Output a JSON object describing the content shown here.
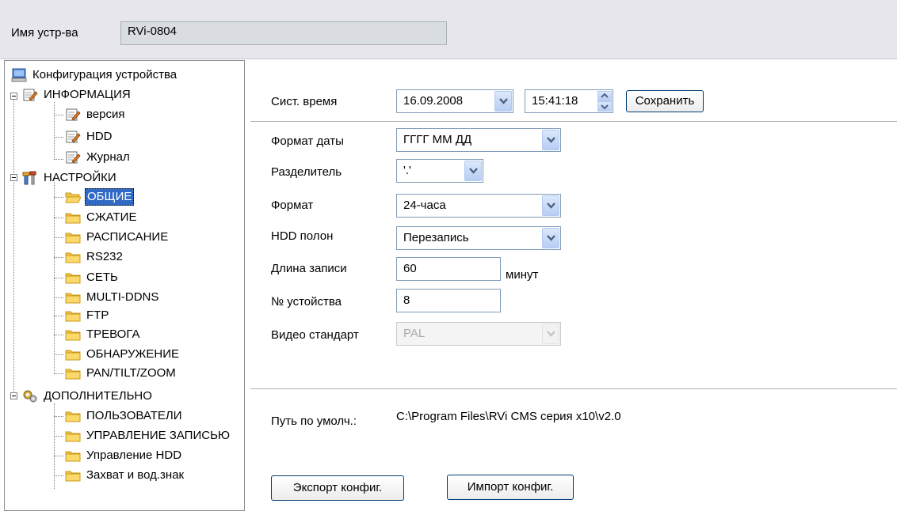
{
  "header": {
    "device_name_label": "Имя устр-ва",
    "device_name_value": "RVi-0804"
  },
  "tree": {
    "root": "Конфигурация устройства",
    "info_group": "ИНФОРМАЦИЯ",
    "info_items": [
      "версия",
      "HDD",
      "Журнал"
    ],
    "settings_group": "НАСТРОЙКИ",
    "settings_items": [
      "ОБЩИЕ",
      "СЖАТИЕ",
      "РАСПИСАНИЕ",
      "RS232",
      "СЕТЬ",
      "MULTI-DDNS",
      "FTP",
      "ТРЕВОГА",
      "ОБНАРУЖЕНИЕ",
      "PAN/TILT/ZOOM"
    ],
    "selected_item": "ОБЩИЕ",
    "extra_group": "ДОПОЛНИТЕЛЬНО",
    "extra_items": [
      "ПОЛЬЗОВАТЕЛИ",
      "УПРАВЛЕНИЕ ЗАПИСЬЮ",
      "Управление HDD",
      "Захват и вод.знак"
    ]
  },
  "system_time": {
    "label": "Сист. время",
    "date": "16.09.2008",
    "time": "15:41:18",
    "save_button": "Сохранить"
  },
  "settings": {
    "date_format": {
      "label": "Формат даты",
      "value": "ГГГГ ММ ДД"
    },
    "separator": {
      "label": "Разделитель",
      "value": "'.'"
    },
    "time_format": {
      "label": "Формат",
      "value": "24-часа"
    },
    "hdd_full": {
      "label": "HDD полон",
      "value": "Перезапись"
    },
    "record_length": {
      "label": "Длина записи",
      "value": "60",
      "unit": "минут"
    },
    "device_no": {
      "label": "№ устойства",
      "value": "8"
    },
    "video_standard": {
      "label": "Видео стандарт",
      "value": "PAL"
    }
  },
  "default_path": {
    "label": "Путь по умолч.:",
    "value": "C:\\Program Files\\RVi CMS серия x10\\v2.0"
  },
  "buttons": {
    "export": "Экспорт конфиг.",
    "import": "Импорт конфиг."
  },
  "colors": {
    "header_bg": "#e6e6ec",
    "selection": "#316ac5",
    "folder": "#f5c342",
    "input_border": "#7f9db9"
  }
}
